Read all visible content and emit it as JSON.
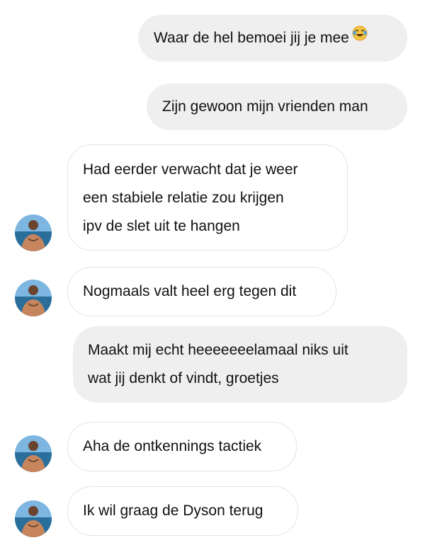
{
  "messages": [
    {
      "direction": "outgoing",
      "lines": [
        "Waar de hel bemoei jij je mee"
      ],
      "emoji": "face-with-tears-of-joy"
    },
    {
      "direction": "outgoing",
      "lines": [
        "Zijn gewoon mijn vrienden man"
      ]
    },
    {
      "direction": "incoming",
      "lines": [
        "Had eerder verwacht dat je weer",
        "een stabiele relatie zou krijgen",
        "ipv de slet uit te hangen"
      ]
    },
    {
      "direction": "incoming",
      "lines": [
        "Nogmaals valt heel erg tegen dit"
      ]
    },
    {
      "direction": "outgoing",
      "lines": [
        "Maakt mij echt heeeeeeelamaal niks uit",
        "wat jij denkt of vindt, groetjes"
      ]
    },
    {
      "direction": "incoming",
      "lines": [
        "Aha de ontkennings tactiek"
      ]
    },
    {
      "direction": "incoming",
      "lines": [
        "Ik wil graag de Dyson terug"
      ]
    }
  ],
  "colors": {
    "outgoing_bubble": "#efefef",
    "incoming_bubble": "#ffffff",
    "incoming_border": "#e3e3e3",
    "text": "#111111"
  }
}
